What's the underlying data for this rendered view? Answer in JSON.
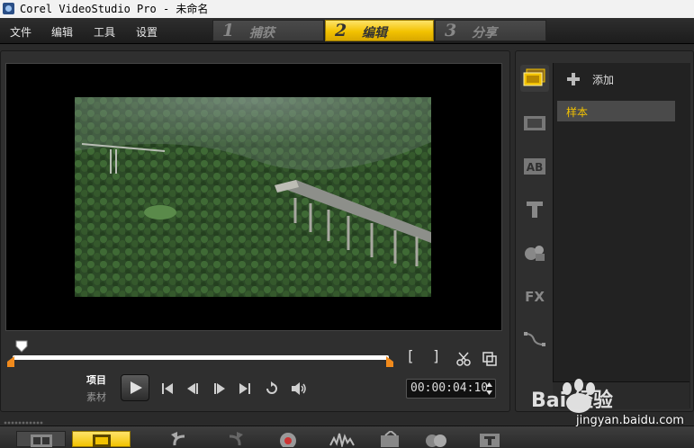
{
  "window": {
    "title": "Corel VideoStudio Pro - 未命名"
  },
  "menu": {
    "items": [
      "文件",
      "编辑",
      "工具",
      "设置"
    ]
  },
  "steps": [
    {
      "num": "1",
      "label": "捕获",
      "active": false
    },
    {
      "num": "2",
      "label": "编辑",
      "active": true
    },
    {
      "num": "3",
      "label": "分享",
      "active": false
    }
  ],
  "preview": {
    "scrubber_position": 0.02,
    "mode_project_label": "项目",
    "mode_clip_label": "素材",
    "timecode": "00:00:04:10",
    "mark_in": "[",
    "mark_out": "]"
  },
  "library": {
    "add_label": "添加",
    "items": [
      {
        "label": "样本",
        "selected": true
      }
    ],
    "tabs": [
      "media-library-icon",
      "transition-icon",
      "title-ab-icon",
      "text-t-icon",
      "graphics-icon",
      "fx-filter-icon",
      "path-icon"
    ]
  },
  "colors": {
    "accent": "#f2c200",
    "background": "#2a2a2a",
    "panel": "#2f2f2f",
    "selected_text": "#f2c200"
  },
  "watermark": {
    "brand": "Bai 经验",
    "url": "jingyan.baidu.com"
  }
}
